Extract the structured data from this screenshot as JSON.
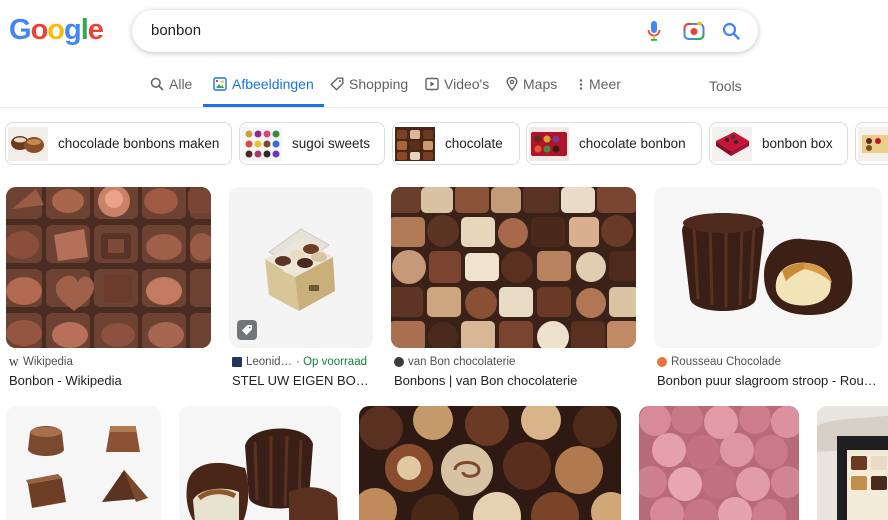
{
  "logo": {
    "letters": [
      "G",
      "o",
      "o",
      "g",
      "l",
      "e"
    ]
  },
  "search": {
    "query": "bonbon"
  },
  "tabs": [
    {
      "label": "Alle",
      "icon": "search-icon"
    },
    {
      "label": "Afbeeldingen",
      "icon": "image-icon",
      "active": true
    },
    {
      "label": "Shopping",
      "icon": "tag-icon"
    },
    {
      "label": "Video's",
      "icon": "play-icon"
    },
    {
      "label": "Maps",
      "icon": "map-pin-icon"
    },
    {
      "label": "Meer",
      "icon": "more-vert-icon"
    }
  ],
  "tools_label": "Tools",
  "chips": [
    {
      "label": "chocolade bonbons maken"
    },
    {
      "label": "sugoi sweets"
    },
    {
      "label": "chocolate"
    },
    {
      "label": "chocolate bonbon"
    },
    {
      "label": "bonbon box"
    },
    {
      "label": ""
    }
  ],
  "results": [
    {
      "source": "Wikipedia",
      "title": "Bonbon - Wikipedia",
      "favicon": "wikipedia-icon"
    },
    {
      "source": "Leonid…",
      "extra": "· Op voorraad",
      "title": "STEL UW EIGEN BO…",
      "favicon": "leonidas-icon",
      "badge": "shopping-tag-icon"
    },
    {
      "source": "van Bon chocolaterie",
      "title": "Bonbons | van Bon chocolaterie",
      "favicon": "vanbon-icon"
    },
    {
      "source": "Rousseau Chocolade",
      "title": "Bonbon puur slagroom stroop - Rou…",
      "favicon": "rousseau-icon"
    }
  ],
  "colors": {
    "accent": "#1a73e8",
    "in_stock": "#188038"
  }
}
